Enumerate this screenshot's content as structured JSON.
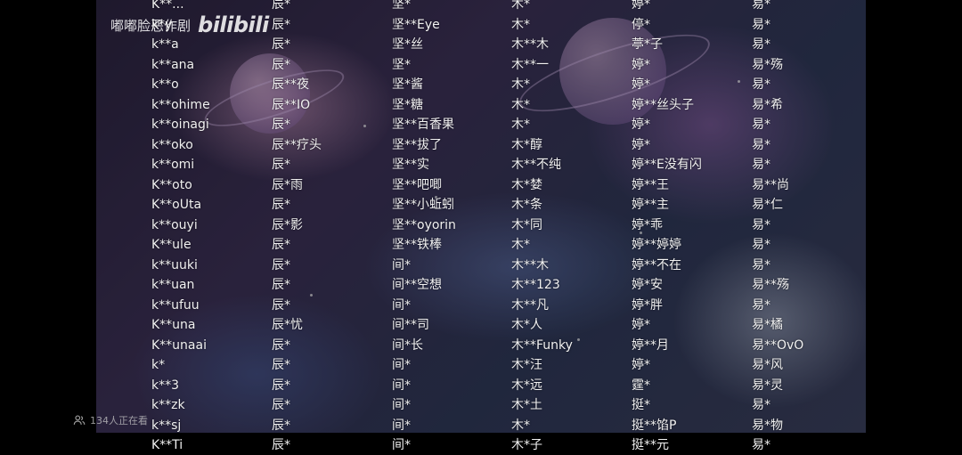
{
  "watermark": {
    "text": "嘟嘟脸恶作剧",
    "logo": "bilibili"
  },
  "viewers": {
    "text": "134人正在看",
    "icon": "people-icon"
  },
  "credits": {
    "rows": [
      [
        "K**...",
        "辰*",
        "坚*",
        "木*",
        "婷*",
        "易*"
      ],
      [
        "k*y",
        "辰*",
        "坚**Eye",
        "木*",
        "停*",
        "易*"
      ],
      [
        "k**a",
        "辰*",
        "坚*丝",
        "木**木",
        "葶*子",
        "易*"
      ],
      [
        "k**ana",
        "辰*",
        "坚*",
        "木**一",
        "婷*",
        "易*殇"
      ],
      [
        "k**o",
        "辰**夜",
        "坚*酱",
        "木*",
        "婷*",
        "易*"
      ],
      [
        "k**ohime",
        "辰**IO",
        "坚*糖",
        "木*",
        "婷**丝头子",
        "易*希"
      ],
      [
        "k**oinagi",
        "辰*",
        "坚**百香果",
        "木*",
        "婷*",
        "易*"
      ],
      [
        "k**oko",
        "辰**疗头",
        "坚**拔了",
        "木*醇",
        "婷*",
        "易*"
      ],
      [
        "k**omi",
        "辰*",
        "坚**实",
        "木**不纯",
        "婷**E没有闪",
        "易*"
      ],
      [
        "K**oto",
        "辰*雨",
        "坚**吧唧",
        "木*婪",
        "婷**王",
        "易**尚"
      ],
      [
        "K**oUta",
        "辰*",
        "坚**小蚯蚓",
        "木*条",
        "婷**主",
        "易*仁"
      ],
      [
        "k**ouyi",
        "辰*影",
        "坚**oyorin",
        "木*同",
        "婷*乖",
        "易*"
      ],
      [
        "K**ule",
        "辰*",
        "坚**铁棒",
        "木*",
        "婷**婷婷",
        "易*"
      ],
      [
        "k**uuki",
        "辰*",
        "间*",
        "木**木",
        "婷**不在",
        "易*"
      ],
      [
        "k**uan",
        "辰*",
        "间**空想",
        "木**123",
        "婷*安",
        "易**殇"
      ],
      [
        "k**ufuu",
        "辰*",
        "间*",
        "木**凡",
        "婷*胖",
        "易*"
      ],
      [
        "K**una",
        "辰*忧",
        "间**司",
        "木*人",
        "婷*",
        "易*橘"
      ],
      [
        "K**unaai",
        "辰*",
        "间*长",
        "木**Funky",
        "婷**月",
        "易**OvO"
      ],
      [
        "k*",
        "辰*",
        "间*",
        "木*汪",
        "婷*",
        "易*风"
      ],
      [
        "k**3",
        "辰*",
        "间*",
        "木*远",
        "霆*",
        "易*灵"
      ],
      [
        "k**zk",
        "辰*",
        "间*",
        "木*土",
        "挺*",
        "易*"
      ],
      [
        "k**sj",
        "辰*",
        "间*",
        "木*",
        "挺**馅P",
        "易*物"
      ],
      [
        "K**Ti",
        "辰*",
        "间*",
        "木*子",
        "挺**元",
        "易*"
      ]
    ]
  }
}
